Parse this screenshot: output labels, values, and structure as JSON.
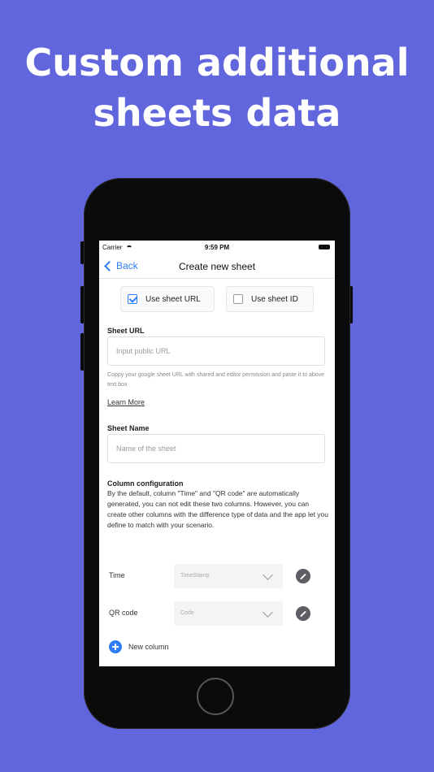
{
  "headline": {
    "line1": "Custom additional",
    "line2": "sheets data"
  },
  "status_bar": {
    "carrier": "Carrier",
    "time": "9:59 PM"
  },
  "nav": {
    "back_label": "Back",
    "title": "Create new sheet"
  },
  "options": {
    "use_sheet_url": "Use sheet URL",
    "use_sheet_id": "Use sheet ID"
  },
  "sheet_url": {
    "label": "Sheet URL",
    "placeholder": "Input public URL",
    "helper": "Coppy your google sheet URL with shared and editor permission and paste it to above text box",
    "learn_more": "Learn More"
  },
  "sheet_name": {
    "label": "Sheet Name",
    "placeholder": "Name of the sheet"
  },
  "column_config": {
    "title": "Column configuration",
    "description": "By the default, column \"Time\" and \"QR code\" are automatically generated, you can not edit these two columns. However, you can create other columns with the difference type of data and the app let you define to match with your scenario.",
    "columns": [
      {
        "name": "Time",
        "type": "TimeStamp"
      },
      {
        "name": "QR code",
        "type": "Code"
      }
    ],
    "new_column": "New column"
  },
  "colors": {
    "background": "#6166dd",
    "accent": "#2f7df6"
  }
}
